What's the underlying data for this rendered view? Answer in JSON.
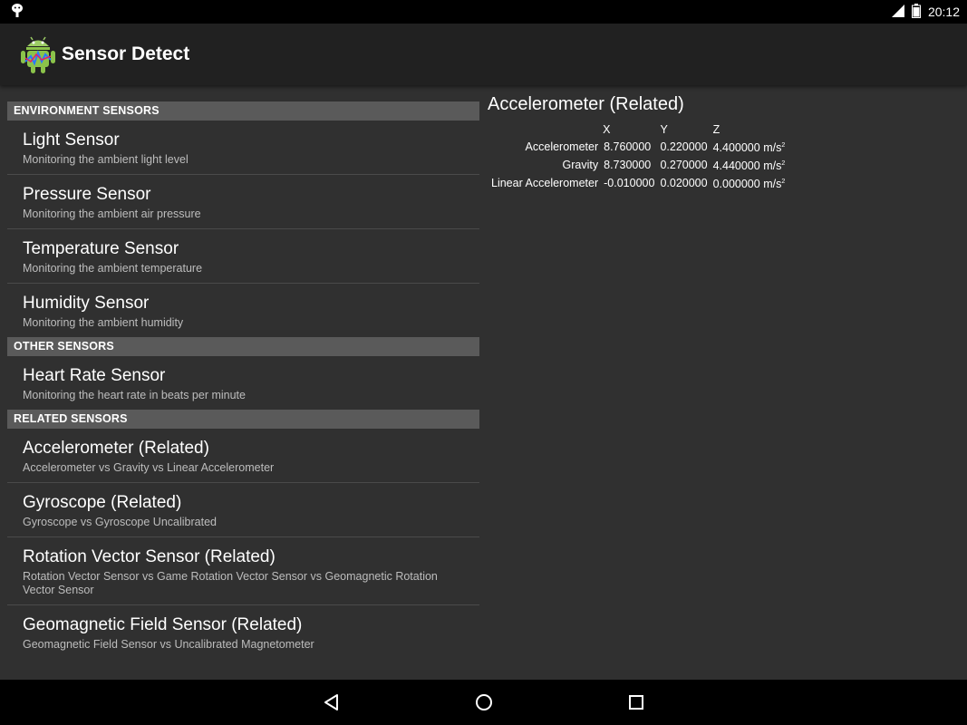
{
  "status_bar": {
    "time": "20:12",
    "icons": [
      "android-notification-icon",
      "signal-icon",
      "battery-icon"
    ]
  },
  "action_bar": {
    "title": "Sensor Detect",
    "icon": "app-android-icon"
  },
  "sections": [
    {
      "header": "ENVIRONMENT SENSORS",
      "items": [
        {
          "title": "Light Sensor",
          "subtitle": "Monitoring the ambient light level"
        },
        {
          "title": "Pressure Sensor",
          "subtitle": "Monitoring the ambient air pressure"
        },
        {
          "title": "Temperature Sensor",
          "subtitle": "Monitoring the ambient temperature"
        },
        {
          "title": "Humidity Sensor",
          "subtitle": "Monitoring the ambient humidity"
        }
      ]
    },
    {
      "header": "OTHER SENSORS",
      "items": [
        {
          "title": "Heart Rate Sensor",
          "subtitle": "Monitoring the heart rate in beats per minute"
        }
      ]
    },
    {
      "header": "RELATED SENSORS",
      "items": [
        {
          "title": "Accelerometer (Related)",
          "subtitle": "Accelerometer vs Gravity vs Linear Accelerometer"
        },
        {
          "title": "Gyroscope (Related)",
          "subtitle": "Gyroscope vs Gyroscope Uncalibrated"
        },
        {
          "title": "Rotation Vector Sensor (Related)",
          "subtitle": "Rotation Vector Sensor vs Game Rotation Vector Sensor vs Geomagnetic Rotation Vector Sensor"
        },
        {
          "title": "Geomagnetic Field Sensor (Related)",
          "subtitle": "Geomagnetic Field Sensor vs Uncalibrated Magnetometer"
        }
      ]
    }
  ],
  "detail": {
    "title": "Accelerometer (Related)",
    "columns": [
      "X",
      "Y",
      "Z"
    ],
    "rows": [
      {
        "label": "Accelerometer",
        "x": "8.760000",
        "y": "0.220000",
        "z": "4.400000",
        "unit": "m/s",
        "unit_sup": "2"
      },
      {
        "label": "Gravity",
        "x": "8.730000",
        "y": "0.270000",
        "z": "4.440000",
        "unit": "m/s",
        "unit_sup": "2"
      },
      {
        "label": "Linear Accelerometer",
        "x": "-0.010000",
        "y": "0.020000",
        "z": "0.000000",
        "unit": "m/s",
        "unit_sup": "2"
      }
    ]
  },
  "nav_bar": {
    "buttons": [
      "back-icon",
      "home-icon",
      "recents-icon"
    ]
  }
}
